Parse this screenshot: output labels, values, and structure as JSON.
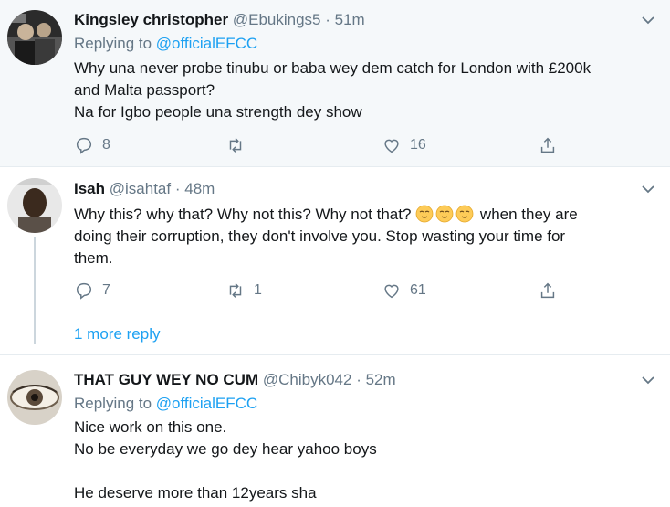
{
  "tweets": [
    {
      "name": "Kingsley christopher",
      "handle": "@Ebukings5",
      "sep": "·",
      "time": "51m",
      "replying_prefix": "Replying to ",
      "replying_to": "@officialEFCC",
      "lines": [
        "Why una never probe tinubu or baba wey dem catch for London with £200k",
        "and Malta passport?",
        "Na for Igbo people una strength dey show"
      ],
      "replies": "8",
      "retweets": "",
      "likes": "16"
    },
    {
      "name": "Isah",
      "handle": "@isahtaf",
      "sep": "·",
      "time": "48m",
      "line1_before": "Why this? why that? Why not this? Why not that?",
      "line1_after": "when they are",
      "emojis": [
        "relieved-face-emoji",
        "relieved-face-emoji",
        "relieved-face-emoji"
      ],
      "lines_rest": [
        "doing their corruption, they don't involve you. Stop wasting your time for",
        "them."
      ],
      "replies": "7",
      "retweets": "1",
      "likes": "61",
      "more_replies": "1 more reply"
    },
    {
      "name": "THAT GUY WEY NO CUM",
      "handle": "@Chibyk042",
      "sep": "·",
      "time": "52m",
      "replying_prefix": "Replying to ",
      "replying_to": "@officialEFCC",
      "lines": [
        "Nice work on this one.",
        "No be everyday we go dey hear yahoo boys",
        "",
        "He deserve more than 12years sha"
      ]
    }
  ],
  "colors": {
    "text": "#14171a",
    "muted": "#657786",
    "link": "#1da1f2",
    "thread_bg": "#f5f8fa"
  },
  "icons": [
    "reply-icon",
    "retweet-icon",
    "like-icon",
    "share-icon",
    "chevron-down-icon"
  ]
}
